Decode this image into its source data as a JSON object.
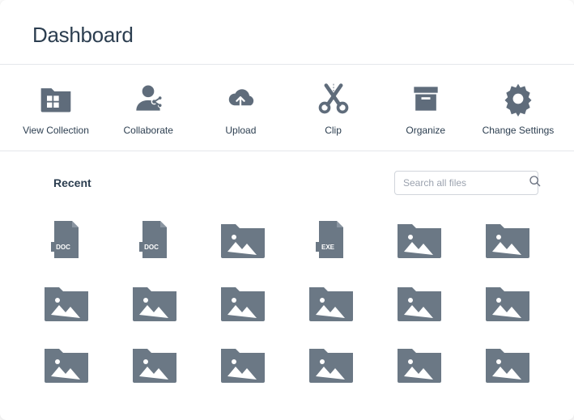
{
  "header": {
    "title": "Dashboard"
  },
  "toolbar": {
    "view_collection": "View Collection",
    "collaborate": "Collaborate",
    "upload": "Upload",
    "clip": "Clip",
    "organize": "Organize",
    "change_settings": "Change Settings"
  },
  "section": {
    "recent_label": "Recent"
  },
  "search": {
    "placeholder": "Search all files"
  },
  "files": {
    "doc_label": "DOC",
    "exe_label": "EXE"
  }
}
